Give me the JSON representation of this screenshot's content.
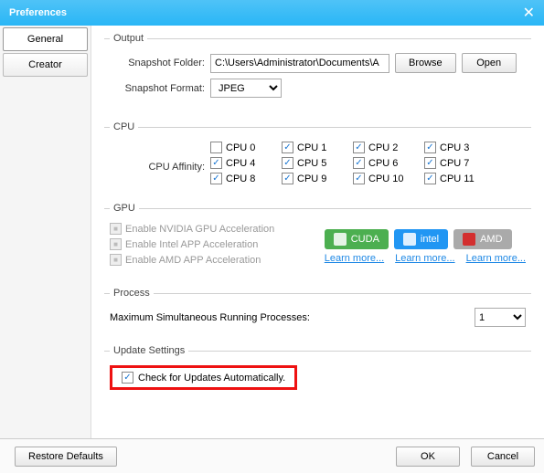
{
  "title": "Preferences",
  "sidebar": {
    "items": [
      "General",
      "Creator"
    ]
  },
  "output": {
    "legend": "Output",
    "folder_label": "Snapshot Folder:",
    "folder_value": "C:\\Users\\Administrator\\Documents\\A",
    "browse": "Browse",
    "open": "Open",
    "format_label": "Snapshot Format:",
    "format_value": "JPEG"
  },
  "cpu": {
    "legend": "CPU",
    "affinity_label": "CPU Affinity:",
    "items": [
      {
        "label": "CPU 0",
        "checked": false
      },
      {
        "label": "CPU 1",
        "checked": true
      },
      {
        "label": "CPU 2",
        "checked": true
      },
      {
        "label": "CPU 3",
        "checked": true
      },
      {
        "label": "CPU 4",
        "checked": true
      },
      {
        "label": "CPU 5",
        "checked": true
      },
      {
        "label": "CPU 6",
        "checked": true
      },
      {
        "label": "CPU 7",
        "checked": true
      },
      {
        "label": "CPU 8",
        "checked": true
      },
      {
        "label": "CPU 9",
        "checked": true
      },
      {
        "label": "CPU 10",
        "checked": true
      },
      {
        "label": "CPU 11",
        "checked": true
      }
    ]
  },
  "gpu": {
    "legend": "GPU",
    "nvidia": "Enable NVIDIA GPU Acceleration",
    "intel": "Enable Intel APP Acceleration",
    "amd": "Enable AMD APP Acceleration",
    "cuda_btn": "CUDA",
    "intel_btn": "intel",
    "amd_btn": "AMD",
    "learn": "Learn more..."
  },
  "process": {
    "legend": "Process",
    "label": "Maximum Simultaneous Running Processes:",
    "value": "1"
  },
  "update": {
    "legend": "Update Settings",
    "label": "Check for Updates Automatically."
  },
  "footer": {
    "restore": "Restore Defaults",
    "ok": "OK",
    "cancel": "Cancel"
  }
}
